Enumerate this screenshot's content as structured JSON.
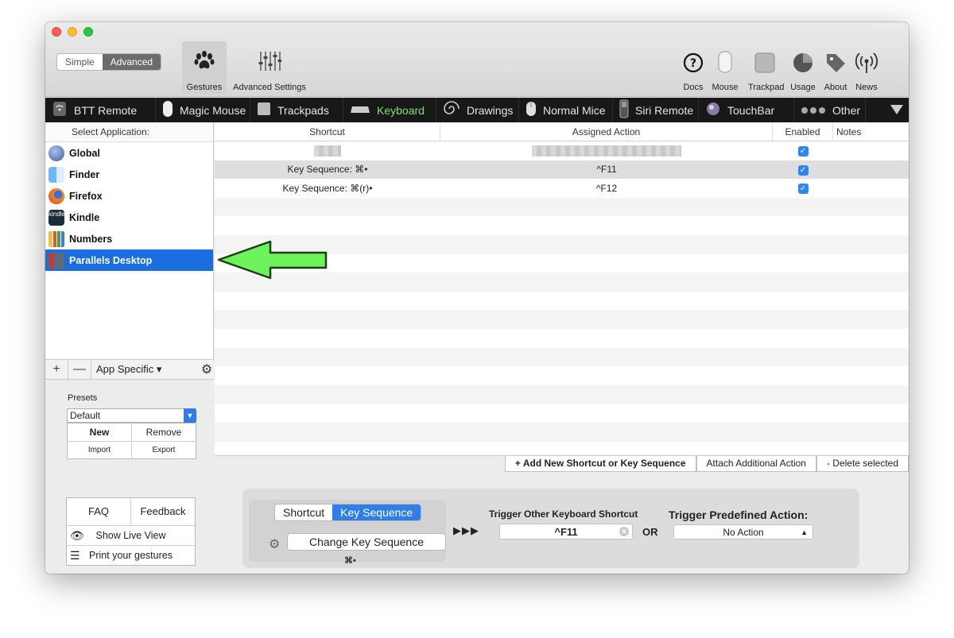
{
  "toolbar": {
    "seg_simple": "Simple",
    "seg_advanced": "Advanced",
    "gestures": "Gestures",
    "advanced_settings": "Advanced Settings",
    "right": [
      "Docs",
      "Mouse",
      "Trackpad",
      "Usage",
      "About",
      "News"
    ]
  },
  "tabs": [
    {
      "label": "BTT Remote",
      "icon": "remote-icon"
    },
    {
      "label": "Magic Mouse",
      "icon": "mouse-icon"
    },
    {
      "label": "Trackpads",
      "icon": "trackpad-icon"
    },
    {
      "label": "Keyboard",
      "icon": "keyboard-icon",
      "active": true
    },
    {
      "label": "Drawings",
      "icon": "drawing-icon"
    },
    {
      "label": "Normal Mice",
      "icon": "normal-mouse-icon"
    },
    {
      "label": "Siri Remote",
      "icon": "siri-remote-icon"
    },
    {
      "label": "TouchBar",
      "icon": "touchbar-icon"
    },
    {
      "label": "Other",
      "icon": "dots-icon"
    }
  ],
  "sidebar": {
    "header": "Select Application:",
    "apps": [
      {
        "label": "Global",
        "color": "#3f5d9a"
      },
      {
        "label": "Finder",
        "color": "#4a9be8"
      },
      {
        "label": "Firefox",
        "color": "#e66b1f"
      },
      {
        "label": "Kindle",
        "color": "#222222"
      },
      {
        "label": "Numbers",
        "color": "#3fa34d"
      },
      {
        "label": "Parallels Desktop",
        "color": "#c63a2f",
        "selected": true
      }
    ],
    "add": "+",
    "remove": "—",
    "app_specific": "App Specific ▾",
    "presets_label": "Presets",
    "preset_value": "Default",
    "new": "New",
    "remove_preset": "Remove",
    "import": "Import",
    "export": "Export",
    "faq": "FAQ",
    "feedback": "Feedback",
    "live_view": "Show Live View",
    "print": "Print your gestures"
  },
  "table": {
    "headers": [
      "Shortcut",
      "Assigned Action",
      "Enabled",
      "Notes"
    ],
    "rows": [
      {
        "shortcut": "",
        "action": "",
        "enabled": true,
        "blurred": true
      },
      {
        "shortcut": "Key Sequence: ⌘•",
        "action": "^F11",
        "enabled": true,
        "selected": true
      },
      {
        "shortcut": "Key Sequence: ⌘(r)•",
        "action": "^F12",
        "enabled": true
      }
    ]
  },
  "actions": {
    "add": "+ Add New Shortcut or Key Sequence",
    "attach": "Attach Additional Action",
    "delete": "- Delete selected"
  },
  "panel": {
    "seg_shortcut": "Shortcut",
    "seg_keyseq": "Key Sequence",
    "change": "Change Key Sequence",
    "keyseq": "⌘•",
    "arrows": "▶▶▶",
    "trigger_label": "Trigger Other Keyboard Shortcut",
    "trigger_value": "^F11",
    "or": "OR",
    "predef_label": "Trigger Predefined Action:",
    "predef_value": "No Action"
  },
  "colors": {
    "accent": "#2f7ee8",
    "selection": "#1a6ee0",
    "active_tab": "#7ee06f",
    "arrow": "#6cf25a"
  }
}
